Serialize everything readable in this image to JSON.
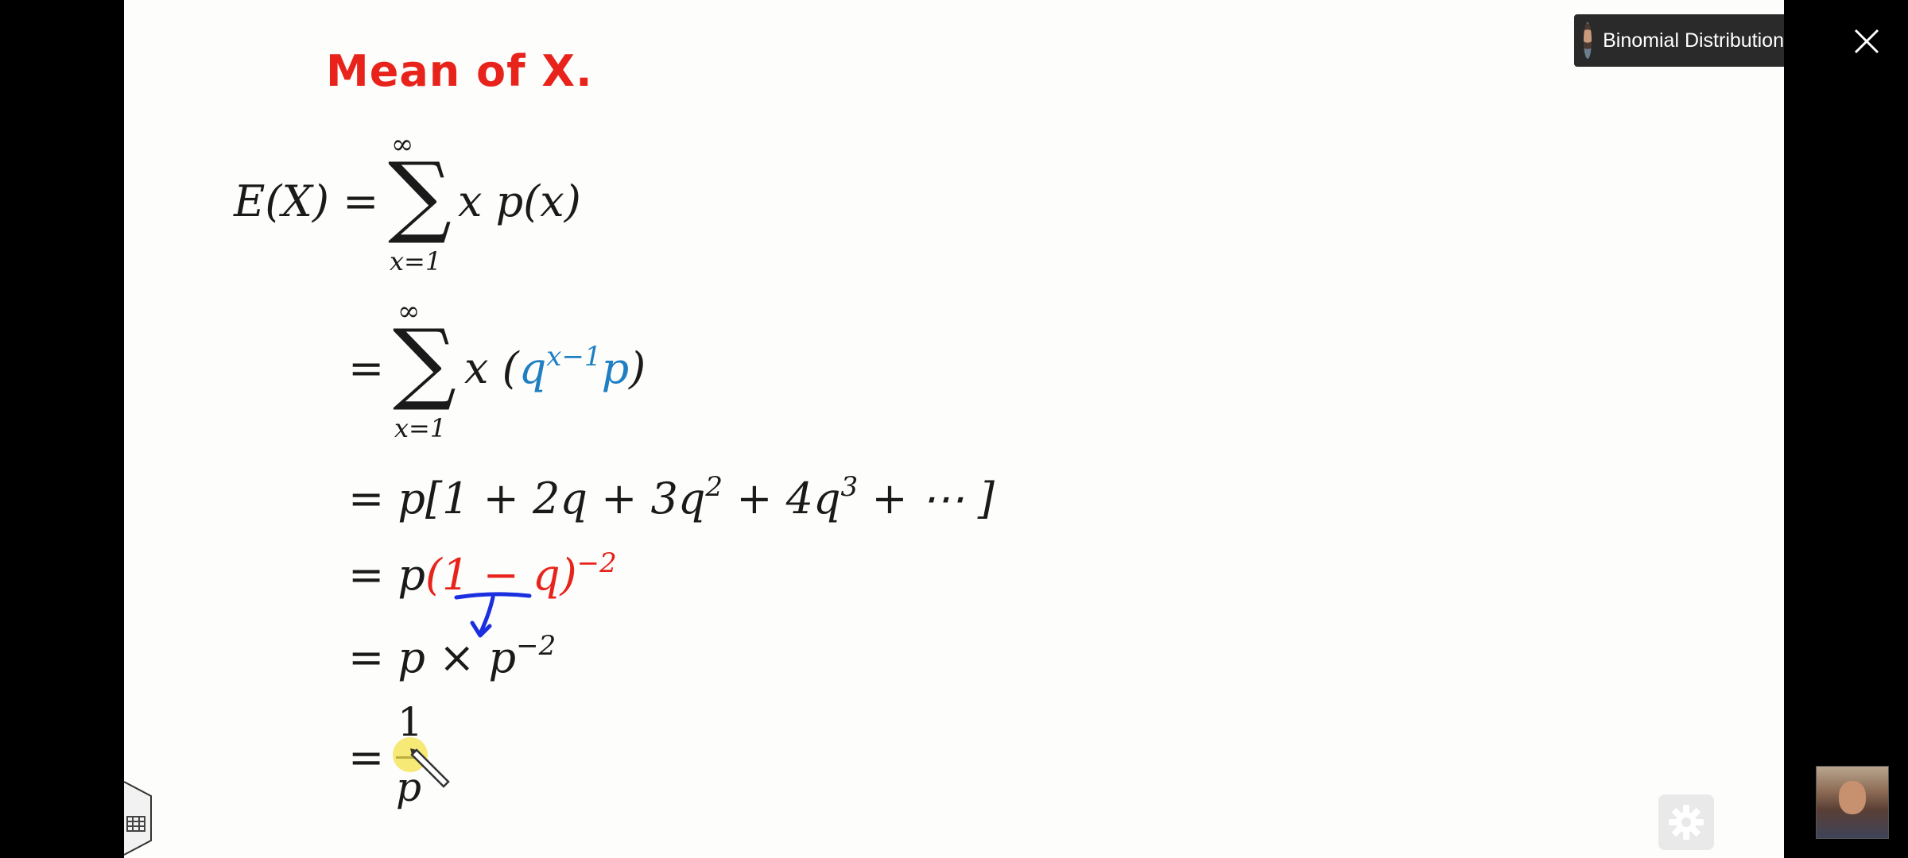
{
  "video": {
    "chip_title": "Binomial Distribution",
    "close_icon": "close-icon",
    "settings_icon": "gear-icon",
    "grid_icon": "grid-icon"
  },
  "slide": {
    "title": "Mean of X.",
    "line1": {
      "lhs": "E(X) =",
      "sum_upper": "∞",
      "sum_lower": "x=1",
      "rhs": "x p(x)"
    },
    "line2": {
      "eq": "=",
      "sum_upper": "∞",
      "sum_lower": "x=1",
      "pre": "x (",
      "q": "q",
      "exp": "x−1",
      "p": "p",
      "post": ")"
    },
    "line3": {
      "text": "= p[1 + 2q + 3q",
      "e1": "2",
      "mid": " + 4q",
      "e2": "3",
      "end": " + ⋯ ]"
    },
    "line4": {
      "pre": "= p",
      "red": "(1 − q)",
      "exp": "−2"
    },
    "line5": {
      "text": "= p × p",
      "exp": "−2"
    },
    "line6": {
      "eq": "=",
      "num": "1",
      "den": "p"
    }
  },
  "colors": {
    "title_red": "#e8231b",
    "blue": "#1f7fc3",
    "ink_blue": "#1a2fe0"
  }
}
